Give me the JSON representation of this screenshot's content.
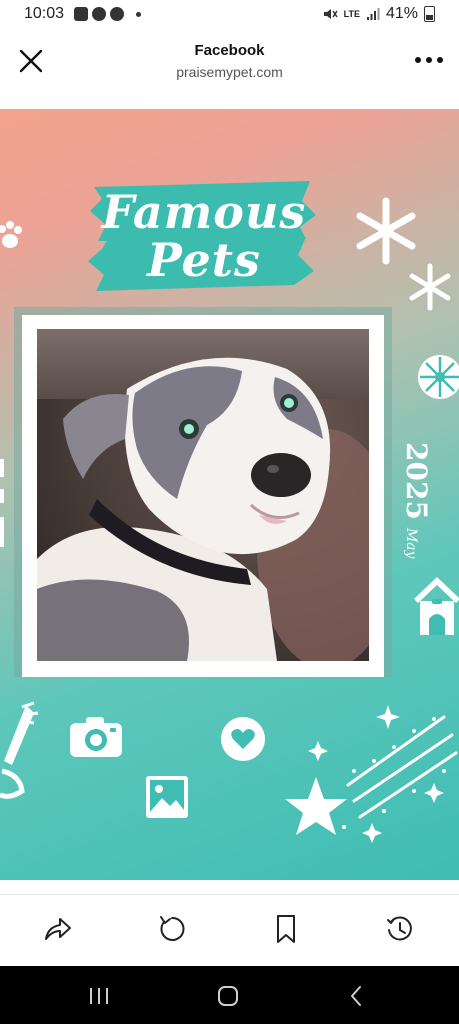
{
  "status_bar": {
    "time": "10:03",
    "network": "LTE",
    "battery": "41%"
  },
  "browser": {
    "title": "Facebook",
    "url": "praisemypet.com",
    "close_icon": "close-icon",
    "menu_icon": "more-icon"
  },
  "banner": {
    "title_line1": "Famous",
    "title_line2": "Pets",
    "month": "May",
    "year": "2025"
  },
  "colors": {
    "gradient_top": "#f4a38d",
    "gradient_bottom": "#3fbdb3",
    "brush_teal": "#3cbcaf"
  },
  "toolbar": {
    "icons": [
      "share-icon",
      "refresh-icon",
      "bookmark-icon",
      "history-icon"
    ]
  },
  "nav": {
    "icons": [
      "recent-apps-icon",
      "home-icon",
      "back-icon"
    ]
  }
}
